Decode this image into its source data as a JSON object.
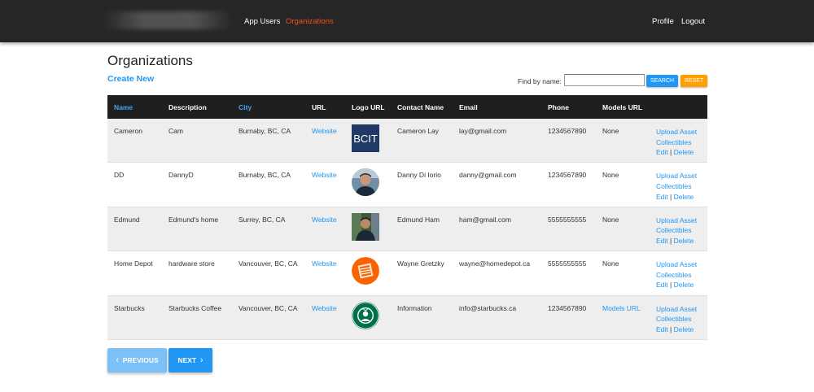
{
  "nav": {
    "links_left": [
      "App Users",
      "Organizations"
    ],
    "links_right": [
      "Profile",
      "Logout"
    ],
    "active": "Organizations",
    "active_color": "#f4511e"
  },
  "page": {
    "title": "Organizations",
    "create_new": "Create New"
  },
  "search": {
    "label": "Find by name:",
    "value": "",
    "search_button": "SEARCH",
    "reset_button": "RESET"
  },
  "table": {
    "columns": [
      "Name",
      "Description",
      "City",
      "URL",
      "Logo URL",
      "Contact Name",
      "Email",
      "Phone",
      "Models URL",
      ""
    ],
    "sortable_columns": [
      "Name",
      "City"
    ],
    "rows": [
      {
        "name": "Cameron",
        "description": "Cam",
        "city": "Burnaby, BC, CA",
        "url": "Website",
        "logo": "bcit-logo",
        "logo_text": "BCIT",
        "contact": "Cameron Lay",
        "email": "lay@gmail.com",
        "phone": "1234567890",
        "models": "None",
        "upload": "Upload Asset",
        "collectibles": "Collectibles",
        "edit": "Edit",
        "sep": "|",
        "delete": "Delete"
      },
      {
        "name": "DD",
        "description": "DannyD",
        "city": "Burnaby, BC, CA",
        "url": "Website",
        "logo": "person-photo",
        "contact": "Danny Di Iorio",
        "email": "danny@gmail.com",
        "phone": "1234567890",
        "models": "None",
        "upload": "Upload Asset",
        "collectibles": "Collectibles",
        "edit": "Edit",
        "sep": "|",
        "delete": "Delete"
      },
      {
        "name": "Edmund",
        "description": "Edmund's home",
        "city": "Surrey, BC, CA",
        "url": "Website",
        "logo": "person-photo",
        "contact": "Edmund Ham",
        "email": "ham@gmail.com",
        "phone": "5555555555",
        "models": "None",
        "upload": "Upload Asset",
        "collectibles": "Collectibles",
        "edit": "Edit",
        "sep": "|",
        "delete": "Delete"
      },
      {
        "name": "Home Depot",
        "description": "hardware store",
        "city": "Vancouver, BC, CA",
        "url": "Website",
        "logo": "home-depot-logo",
        "contact": "Wayne Gretzky",
        "email": "wayne@homedepot.ca",
        "phone": "5555555555",
        "models": "None",
        "upload": "Upload Asset",
        "collectibles": "Collectibles",
        "edit": "Edit",
        "sep": "|",
        "delete": "Delete"
      },
      {
        "name": "Starbucks",
        "description": "Starbucks Coffee",
        "city": "Vancouver, BC, CA",
        "url": "Website",
        "logo": "starbucks-logo",
        "contact": "Information",
        "email": "info@starbucks.ca",
        "phone": "1234567890",
        "models": "Models URL",
        "upload": "Upload Asset",
        "collectibles": "Collectibles",
        "edit": "Edit",
        "sep": "|",
        "delete": "Delete"
      }
    ]
  },
  "pagination": {
    "previous": "PREVIOUS",
    "next": "NEXT"
  },
  "colors": {
    "navbar": "#262626",
    "accent": "#2196f3",
    "reset": "#ffa000",
    "table_header": "#1f1f1f"
  }
}
